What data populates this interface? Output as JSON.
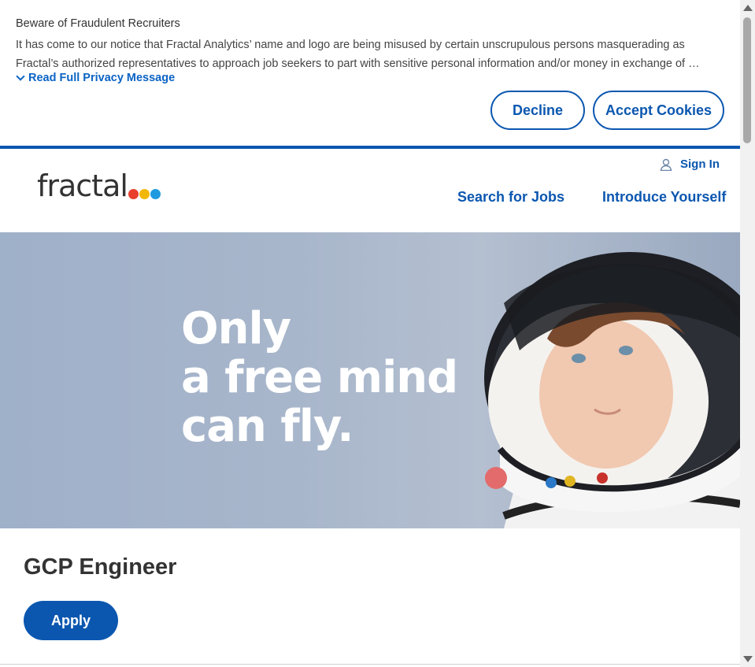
{
  "banner": {
    "title": "Beware of Fraudulent Recruiters",
    "line1": "It has come to our notice that Fractal Analytics’ name and logo are being misused by certain unscrupulous persons masquerading as",
    "line2": "Fractal’s authorized representatives to approach job seekers to part with sensitive personal information and/or money in exchange of …",
    "read_more": "Read Full Privacy Message",
    "decline_label": "Decline",
    "accept_label": "Accept Cookies"
  },
  "header": {
    "logo_text": "fractal",
    "logo_dot_colors": [
      "#e8402d",
      "#f2b705",
      "#1e9be0"
    ],
    "sign_in": "Sign In",
    "nav": {
      "search_jobs": "Search for Jobs",
      "introduce": "Introduce Yourself"
    }
  },
  "hero": {
    "line1": "Only",
    "line2": "a free mind",
    "line3": "can fly."
  },
  "job": {
    "title": "GCP Engineer",
    "apply_label": "Apply"
  },
  "colors": {
    "brand_blue": "#0b57b0",
    "link_blue": "#0b63c5"
  }
}
